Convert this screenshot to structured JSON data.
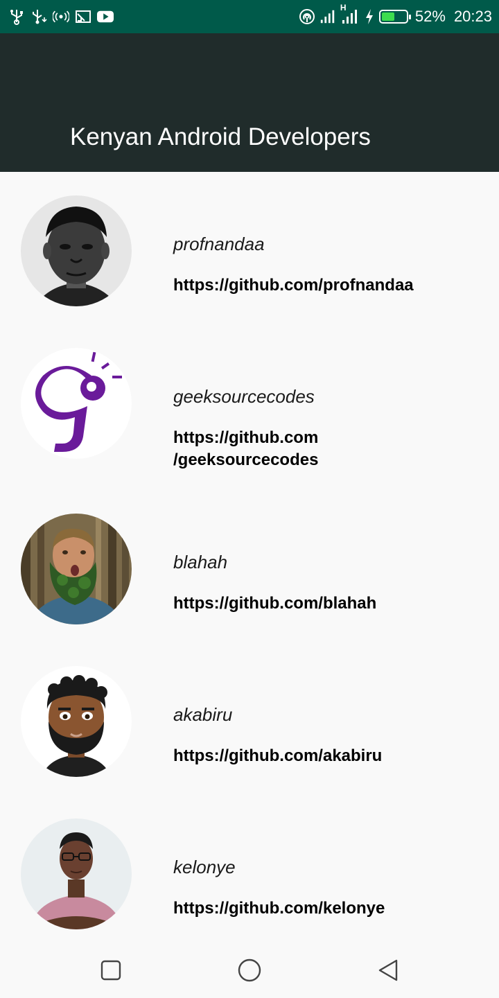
{
  "status_bar": {
    "icons": [
      "usb-icon",
      "usb-debug-icon",
      "hotspot-icon",
      "cast-icon",
      "youtube-icon"
    ],
    "right_icons": [
      "nfc-icon",
      "signal-icon",
      "network-h-icon",
      "charging-icon"
    ],
    "network_type": "H",
    "battery_level": 0.52,
    "battery_percent": "52%",
    "time": "20:23"
  },
  "app_bar": {
    "title": "Kenyan Android Developers"
  },
  "developers": [
    {
      "username": "profnandaa",
      "url": "https://github.com/profnandaa"
    },
    {
      "username": "geeksourcecodes",
      "url_line1": "https://github.com",
      "url_line2": "/geeksourcecodes"
    },
    {
      "username": "blahah",
      "url": "https://github.com/blahah"
    },
    {
      "username": "akabiru",
      "url": "https://github.com/akabiru"
    },
    {
      "username": "kelonye",
      "url": "https://github.com/kelonye"
    }
  ],
  "nav_bar": {
    "buttons": [
      "recent-apps-icon",
      "home-icon",
      "back-icon"
    ]
  },
  "colors": {
    "status_bar": "#005a4a",
    "app_bar": "#202c2b",
    "background": "#f9f9f9",
    "battery_fill": "#3ddc4f",
    "geek_logo": "#6a1b9a"
  }
}
